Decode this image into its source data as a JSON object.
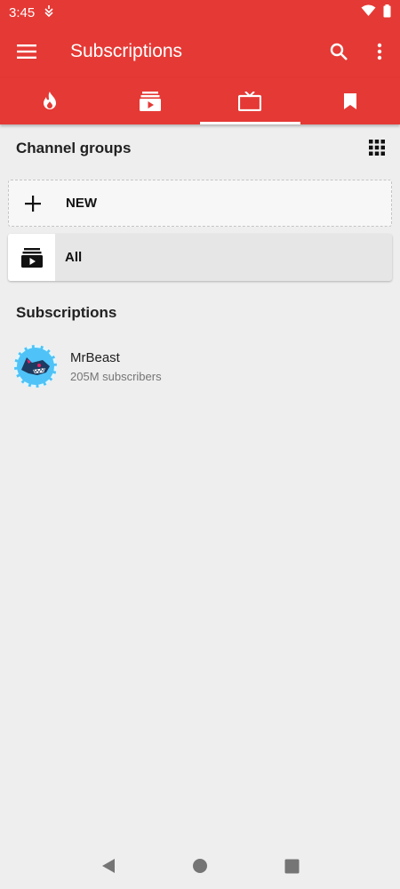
{
  "status_bar": {
    "time": "3:45"
  },
  "app_bar": {
    "title": "Subscriptions"
  },
  "tabs": [
    {
      "icon": "fire-icon",
      "active": false
    },
    {
      "icon": "subscription-feed-icon",
      "active": false
    },
    {
      "icon": "tv-icon",
      "active": true
    },
    {
      "icon": "bookmark-icon",
      "active": false
    }
  ],
  "channel_groups": {
    "title": "Channel groups",
    "new_label": "NEW",
    "all_label": "All"
  },
  "subscriptions": {
    "title": "Subscriptions",
    "items": [
      {
        "name": "MrBeast",
        "subscribers": "205M subscribers"
      }
    ]
  },
  "colors": {
    "primary": "#e53935",
    "background": "#eeeeee"
  }
}
